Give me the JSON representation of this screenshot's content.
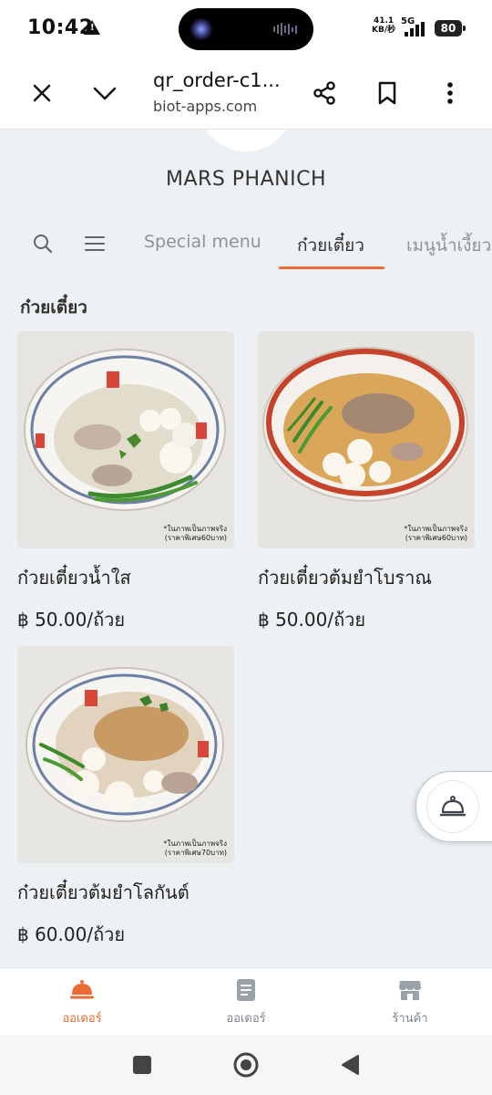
{
  "status_bar": {
    "time": "10:42",
    "net_speed_value": "41.1",
    "net_speed_unit": "KB/秒",
    "network": "5G",
    "battery": "80"
  },
  "browser": {
    "title": "qr_order-c1...",
    "url": "biot-apps.com",
    "icons": [
      "close-icon",
      "chevron-down-icon",
      "share-icon",
      "bookmark-icon",
      "more-vert-icon"
    ]
  },
  "shop": {
    "name": "MARS PHANICH"
  },
  "tabs": [
    {
      "label": "Special menu",
      "active": false
    },
    {
      "label": "ก๋วยเตี๋ยว",
      "active": true
    },
    {
      "label": "เมนูน้ำเงี้ยว",
      "active": false
    }
  ],
  "section": {
    "title": "ก๋วยเตี๋ยว"
  },
  "items": [
    {
      "name": "ก๋วยเตี๋ยวน้ำใส",
      "price": "฿ 50.00/ถ้วย",
      "image_note_1": "*ในภาพเป็นภาพจริง",
      "image_note_2": "(ราคาพิเศษ60บาท)"
    },
    {
      "name": "ก๋วยเตี๋ยวต้มยำโบราณ",
      "price": "฿ 50.00/ถ้วย",
      "image_note_1": "*ในภาพเป็นภาพจริง",
      "image_note_2": "(ราคาพิเศษ60บาท)"
    },
    {
      "name": "ก๋วยเตี๋ยวต้มยำโลกันต์",
      "price": "฿ 60.00/ถ้วย",
      "image_note_1": "*ในภาพเป็นภาพจริง",
      "image_note_2": "(ราคาพิเศษ70บาท)"
    }
  ],
  "bottom_nav": [
    {
      "label": "ออเดอร์",
      "icon": "food-cloche-icon",
      "active": true
    },
    {
      "label": "ออเดอร์",
      "icon": "receipt-icon",
      "active": false
    },
    {
      "label": "ร้านค้า",
      "icon": "store-icon",
      "active": false
    }
  ],
  "colors": {
    "accent": "#ea6b34",
    "background": "#eef1f3"
  }
}
